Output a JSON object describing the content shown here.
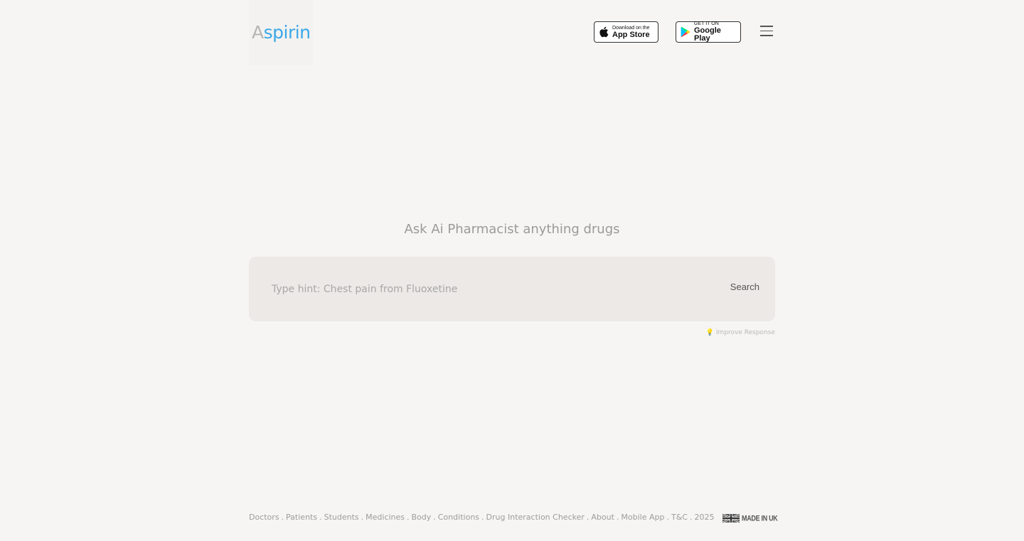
{
  "header": {
    "logo_first": "A",
    "logo_rest": "spirin",
    "app_store": {
      "small": "Download on the",
      "big": "App Store"
    },
    "google_play": {
      "small": "GET IT ON",
      "big": "Google Play"
    }
  },
  "main": {
    "tagline": "Ask Ai Pharmacist anything drugs",
    "search": {
      "placeholder": "Type hint: Chest pain from Fluoxetine",
      "button_label": "Search"
    },
    "improve_label": "Improve Response"
  },
  "footer": {
    "links": [
      "Doctors",
      "Patients",
      "Students",
      "Medicines",
      "Body",
      "Conditions",
      "Drug Interaction Checker",
      "About",
      "Mobile App",
      "T&C",
      "2025"
    ],
    "made_in": "MADE IN UK"
  },
  "colors": {
    "brand_blue": "#3aa7e8",
    "background": "#f6f5f3",
    "search_bg": "#ece9e6"
  },
  "icons": {
    "apple": "apple-icon",
    "google_play": "google-play-icon",
    "menu": "hamburger-menu-icon",
    "bulb": "lightbulb-icon",
    "flag": "uk-flag-icon"
  }
}
